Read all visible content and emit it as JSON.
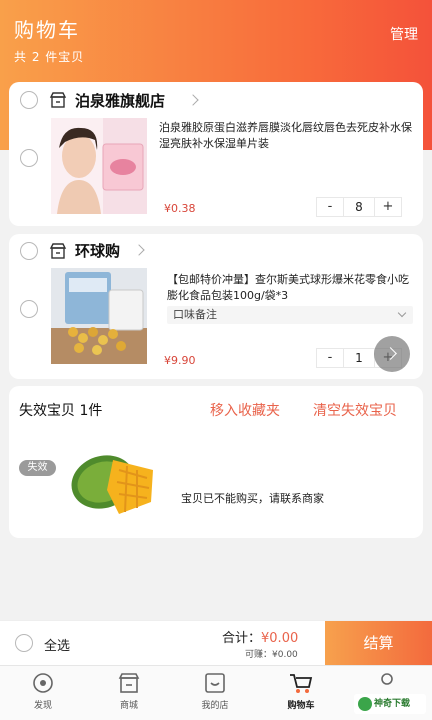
{
  "header": {
    "title": "购物车",
    "subtitle": "共 2 件宝贝",
    "manage": "管理"
  },
  "shops": [
    {
      "name": "泊泉雅旗舰店",
      "item": {
        "title": "泊泉雅胶原蛋白滋养唇膜淡化唇纹唇色去死皮补水保湿亮肤补水保湿单片装",
        "price": "¥0.38",
        "qty": "8"
      }
    },
    {
      "name": "环球购",
      "item": {
        "title": "【包邮特价冲量】查尔斯美式球形爆米花零食小吃 膨化食品包装100g/袋*3",
        "spec": "口味备注",
        "price": "¥9.90",
        "qty": "1"
      }
    }
  ],
  "stepper": {
    "minus": "-",
    "plus": "+"
  },
  "invalid": {
    "title": "失效宝贝 1件",
    "move_to_favorites": "移入收藏夹",
    "clear": "清空失效宝贝",
    "badge": "失效",
    "message": "宝贝已不能购买，请联系商家"
  },
  "checkout": {
    "select_all": "全选",
    "total_label": "合计：",
    "total_value": "¥0.00",
    "earn": "可赚：¥0.00",
    "settle": "结算"
  },
  "tabs": [
    {
      "label": "发现",
      "icon": "discover-icon"
    },
    {
      "label": "商城",
      "icon": "store-icon"
    },
    {
      "label": "我的店",
      "icon": "my-shop-icon"
    },
    {
      "label": "购物车",
      "icon": "cart-icon",
      "active": true
    },
    {
      "label": "",
      "icon": "profile-icon"
    }
  ],
  "watermark": "神奇下载",
  "colors": {
    "accent": "#f86b3b",
    "price": "#d8463a",
    "link": "#e9634b"
  }
}
